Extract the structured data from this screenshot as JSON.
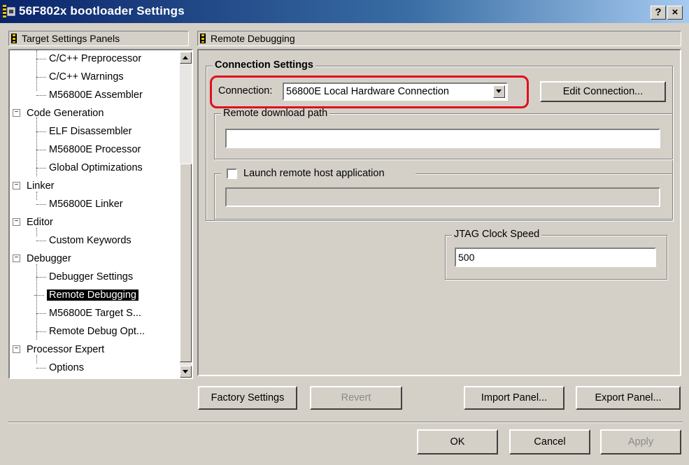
{
  "window": {
    "title": "56F802x bootloader Settings",
    "help_label": "?",
    "close_label": "×"
  },
  "left_panel": {
    "header": "Target Settings Panels",
    "tree": [
      {
        "label": "C/C++ Preprocessor",
        "level": 2
      },
      {
        "label": "C/C++ Warnings",
        "level": 2
      },
      {
        "label": "M56800E Assembler",
        "level": 2
      },
      {
        "label": "Code Generation",
        "level": 1,
        "expander": "−"
      },
      {
        "label": "ELF Disassembler",
        "level": 2
      },
      {
        "label": "M56800E Processor",
        "level": 2
      },
      {
        "label": "Global Optimizations",
        "level": 2
      },
      {
        "label": "Linker",
        "level": 1,
        "expander": "−"
      },
      {
        "label": "M56800E Linker",
        "level": 2
      },
      {
        "label": "Editor",
        "level": 1,
        "expander": "−"
      },
      {
        "label": "Custom Keywords",
        "level": 2
      },
      {
        "label": "Debugger",
        "level": 1,
        "expander": "−"
      },
      {
        "label": "Debugger Settings",
        "level": 2
      },
      {
        "label": "Remote Debugging",
        "level": 2,
        "selected": true
      },
      {
        "label": "M56800E Target S...",
        "level": 2
      },
      {
        "label": "Remote Debug Opt...",
        "level": 2
      },
      {
        "label": "Processor Expert",
        "level": 1,
        "expander": "−"
      },
      {
        "label": "Options",
        "level": 2
      }
    ]
  },
  "right_panel": {
    "header": "Remote Debugging",
    "connection_settings": {
      "legend": "Connection Settings",
      "connection_label": "Connection:",
      "connection_value": "56800E Local Hardware Connection",
      "edit_button": "Edit Connection..."
    },
    "remote_download": {
      "legend": "Remote download path",
      "value": ""
    },
    "launch_remote": {
      "label": "Launch remote host application",
      "checked": false,
      "value": ""
    },
    "jtag": {
      "legend": "JTAG Clock Speed",
      "value": "500"
    }
  },
  "buttons": {
    "factory_settings": "Factory Settings",
    "revert": "Revert",
    "import_panel": "Import Panel...",
    "export_panel": "Export Panel...",
    "ok": "OK",
    "cancel": "Cancel",
    "apply": "Apply"
  },
  "colors": {
    "title_bar": "#0a246a",
    "highlight_outline": "#e0101a",
    "selection": "#000000"
  }
}
